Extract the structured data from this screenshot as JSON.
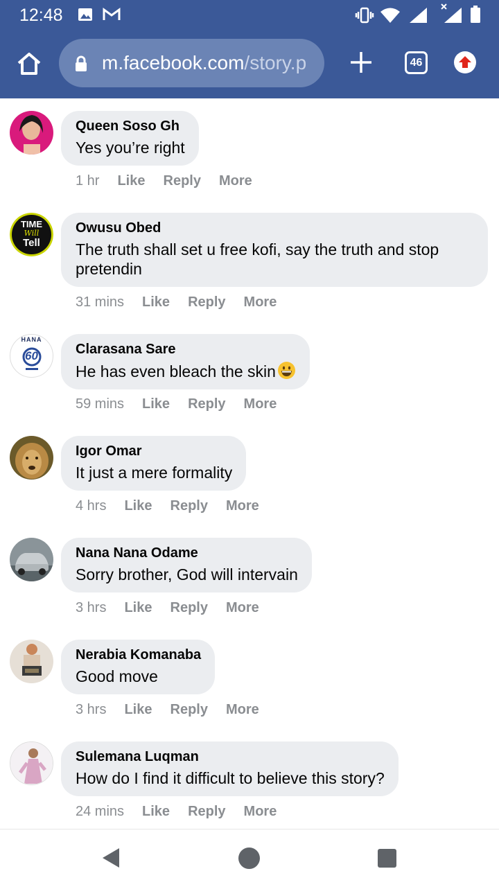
{
  "status_bar": {
    "time": "12:48",
    "icons": [
      "image-icon",
      "gmail-icon",
      "vibrate-icon",
      "wifi-icon",
      "signal-icon",
      "signal-x-icon",
      "battery-icon"
    ]
  },
  "browser": {
    "url_host": "m.facebook.com",
    "url_path": "/story.p",
    "tab_count": "46",
    "icons": [
      "home-icon",
      "lock-icon",
      "plus-icon",
      "tabs-icon",
      "upload-icon"
    ]
  },
  "colors": {
    "header": "#3b5998",
    "bubble": "#ebedf0",
    "meta": "#8a8d91"
  },
  "comments": [
    {
      "author": "Queen Soso Gh",
      "text": "Yes you’re right",
      "time": "1 hr",
      "like": "Like",
      "reply": "Reply",
      "more": "More"
    },
    {
      "author": "Owusu Obed",
      "text": "The truth shall set u free kofi, say the truth and stop pretendin",
      "time": "31 mins",
      "like": "Like",
      "reply": "Reply",
      "more": "More"
    },
    {
      "author": "Clarasana Sare",
      "text": "He has even bleach the skin",
      "time": "59 mins",
      "like": "Like",
      "reply": "Reply",
      "more": "More"
    },
    {
      "author": "Igor Omar",
      "text": "It just a mere formality",
      "time": "4 hrs",
      "like": "Like",
      "reply": "Reply",
      "more": "More"
    },
    {
      "author": "Nana Nana Odame",
      "text": "Sorry brother, God will intervain",
      "time": "3 hrs",
      "like": "Like",
      "reply": "Reply",
      "more": "More"
    },
    {
      "author": "Nerabia Komanaba",
      "text": "Good move",
      "time": "3 hrs",
      "like": "Like",
      "reply": "Reply",
      "more": "More"
    },
    {
      "author": "Sulemana Luqman",
      "text": "How do I find it difficult to believe this story?",
      "time": "24 mins",
      "like": "Like",
      "reply": "Reply",
      "more": "More"
    }
  ],
  "avatar_logo": {
    "top": "TIME",
    "middle": "Will",
    "bottom": "Tell"
  },
  "avatar_badge": {
    "arc": "HANA",
    "number": "60"
  },
  "nav": {
    "icons": [
      "back-icon",
      "home-circle-icon",
      "recents-icon"
    ]
  }
}
